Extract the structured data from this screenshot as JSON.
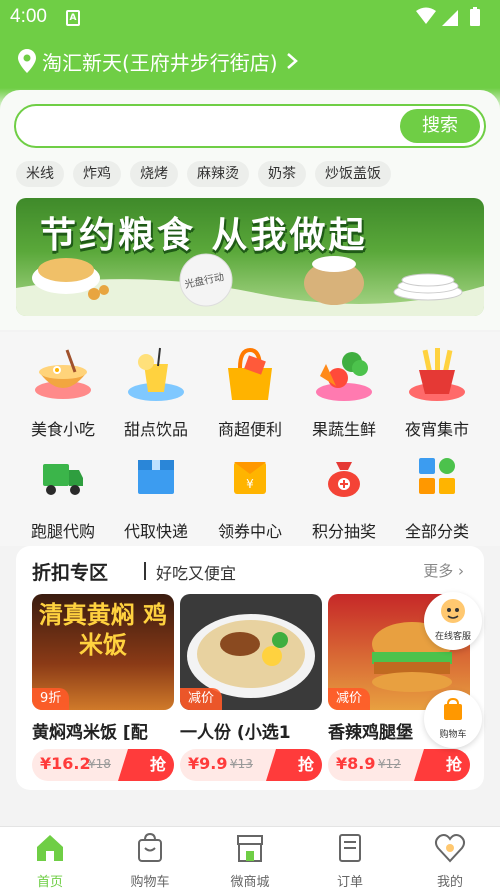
{
  "status_bar": {
    "time": "4:00",
    "notif_glyph": "A"
  },
  "location": {
    "name": "淘汇新天(王府井步行街店)"
  },
  "search": {
    "placeholder": "",
    "button_label": "搜索"
  },
  "quick_tags": [
    "米线",
    "炸鸡",
    "烧烤",
    "麻辣烫",
    "奶茶",
    "炒饭盖饭"
  ],
  "banner": {
    "headline": "节约粮食  从我做起",
    "stamp": "光盘行动"
  },
  "categories": [
    {
      "label": "美食小吃",
      "icon": "noodle-bowl-icon"
    },
    {
      "label": "甜点饮品",
      "icon": "drink-icon"
    },
    {
      "label": "商超便利",
      "icon": "shopping-bag-icon"
    },
    {
      "label": "果蔬生鲜",
      "icon": "vegetables-icon"
    },
    {
      "label": "夜宵集市",
      "icon": "fries-icon"
    },
    {
      "label": "跑腿代购",
      "icon": "delivery-truck-icon"
    },
    {
      "label": "代取快递",
      "icon": "package-box-icon"
    },
    {
      "label": "领券中心",
      "icon": "coupon-icon"
    },
    {
      "label": "积分抽奖",
      "icon": "lucky-bag-icon"
    },
    {
      "label": "全部分类",
      "icon": "grid-icon"
    }
  ],
  "discount": {
    "title": "折扣专区",
    "subtitle": "好吃又便宜",
    "more": "更多",
    "products": [
      {
        "name": "黄焖鸡米饭 [配",
        "badge": "9折",
        "price": "¥16.2",
        "original": "¥18",
        "buy": "抢",
        "image_text": "清真黄焖 鸡米饭"
      },
      {
        "name": "一人份 (小选1",
        "badge": "减价",
        "price": "¥9.9",
        "original": "¥13",
        "buy": "抢"
      },
      {
        "name": "香辣鸡腿堡",
        "badge": "减价",
        "price": "¥8.9",
        "original": "¥12",
        "buy": "抢"
      }
    ]
  },
  "floating": {
    "service": "在线客服",
    "cart": "购物车"
  },
  "tabbar": [
    {
      "label": "首页",
      "active": true
    },
    {
      "label": "购物车",
      "active": false
    },
    {
      "label": "微商城",
      "active": false
    },
    {
      "label": "订单",
      "active": false
    },
    {
      "label": "我的",
      "active": false
    }
  ],
  "colors": {
    "primary": "#6fce45",
    "price_red": "#ff3b3b"
  }
}
